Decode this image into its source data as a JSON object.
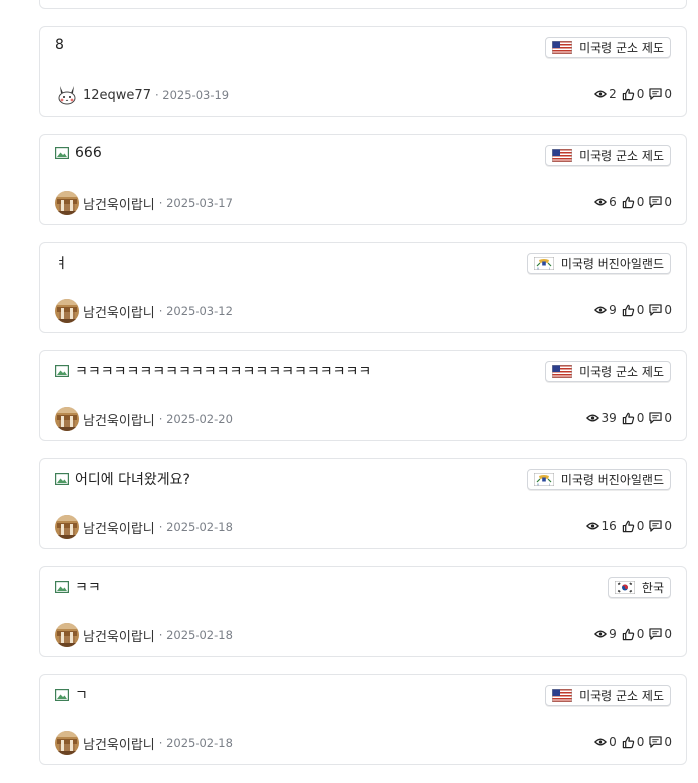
{
  "posts": [
    {
      "title": "8",
      "has_image": false,
      "category": "미국령 군소 제도",
      "flag": "us-flag-icon",
      "author": "12eqwe77",
      "avatar": "pikachu",
      "date": "2025-03-19",
      "views": "2",
      "likes": "0",
      "comments": "0"
    },
    {
      "title": "666",
      "has_image": true,
      "category": "미국령 군소 제도",
      "flag": "us-flag-icon",
      "author": "남건욱이랍니",
      "avatar": "photo",
      "date": "2025-03-17",
      "views": "6",
      "likes": "0",
      "comments": "0"
    },
    {
      "title": "ㅕ",
      "has_image": false,
      "category": "미국령 버진아일랜드",
      "flag": "usvi-flag-icon",
      "author": "남건욱이랍니",
      "avatar": "photo",
      "date": "2025-03-12",
      "views": "9",
      "likes": "0",
      "comments": "0"
    },
    {
      "title": "ㅋㅋㅋㅋㅋㅋㅋㅋㅋㅋㅋㅋㅋㅋㅋㅋㅋㅋㅋㅋㅋㅋㅋ",
      "has_image": true,
      "category": "미국령 군소 제도",
      "flag": "us-flag-icon",
      "author": "남건욱이랍니",
      "avatar": "photo",
      "date": "2025-02-20",
      "views": "39",
      "likes": "0",
      "comments": "0"
    },
    {
      "title": "어디에 다녀왔게요?",
      "has_image": true,
      "category": "미국령 버진아일랜드",
      "flag": "usvi-flag-icon",
      "author": "남건욱이랍니",
      "avatar": "photo",
      "date": "2025-02-18",
      "views": "16",
      "likes": "0",
      "comments": "0"
    },
    {
      "title": "ㅋㅋ",
      "has_image": true,
      "category": "한국",
      "flag": "kr-flag-icon",
      "author": "남건욱이랍니",
      "avatar": "photo",
      "date": "2025-02-18",
      "views": "9",
      "likes": "0",
      "comments": "0"
    },
    {
      "title": "ㄱ",
      "has_image": true,
      "category": "미국령 군소 제도",
      "flag": "us-flag-icon",
      "author": "남건욱이랍니",
      "avatar": "photo",
      "date": "2025-02-18",
      "views": "0",
      "likes": "0",
      "comments": "0"
    }
  ]
}
